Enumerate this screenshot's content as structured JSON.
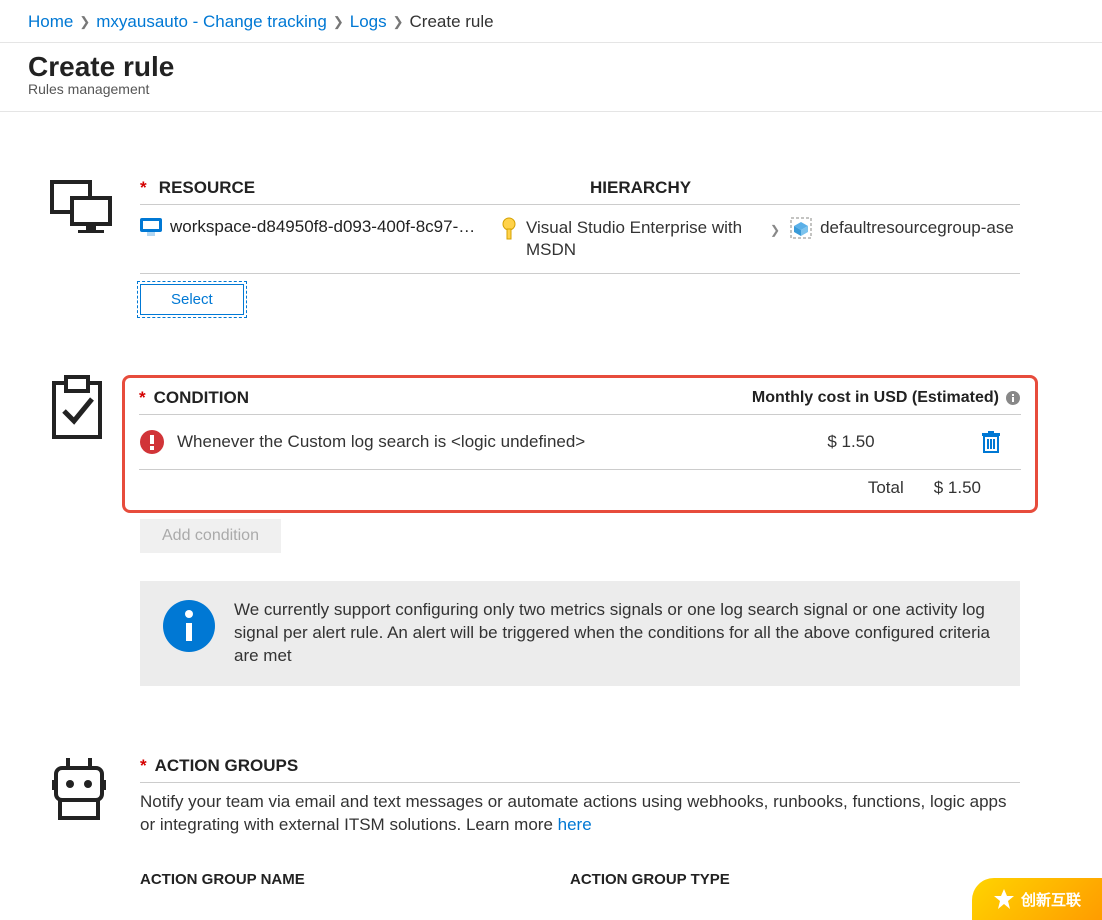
{
  "breadcrumbs": {
    "home": "Home",
    "item1": "mxyausauto - Change tracking",
    "item2": "Logs",
    "current": "Create rule"
  },
  "page_header": {
    "title": "Create rule",
    "subtitle": "Rules management"
  },
  "resource_section": {
    "title": "RESOURCE",
    "hierarchy_label": "HIERARCHY",
    "workspace_name": "workspace-d84950f8-d093-400f-8c97-…",
    "hierarchy": {
      "subscription": "Visual Studio Enterprise with MSDN",
      "resource_group": "defaultresourcegroup-ase"
    },
    "select_button": "Select"
  },
  "condition_section": {
    "title": "CONDITION",
    "cost_label": "Monthly cost in USD (Estimated)",
    "row_text": "Whenever the Custom log search is <logic undefined>",
    "row_cost": "$ 1.50",
    "total_label": "Total",
    "total_value": "$ 1.50",
    "add_condition": "Add condition",
    "info_text": "We currently support configuring only two metrics signals or one log search signal or one activity log signal per alert rule. An alert will be triggered when the conditions for all the above configured criteria are met"
  },
  "action_groups_section": {
    "title": "ACTION GROUPS",
    "description_pre": "Notify your team via email and text messages or automate actions using webhooks, runbooks, functions, logic apps or integrating with external ITSM solutions. Learn more ",
    "learn_more": "here",
    "col_name": "ACTION GROUP NAME",
    "col_type": "ACTION GROUP TYPE"
  },
  "watermark": "创新互联"
}
